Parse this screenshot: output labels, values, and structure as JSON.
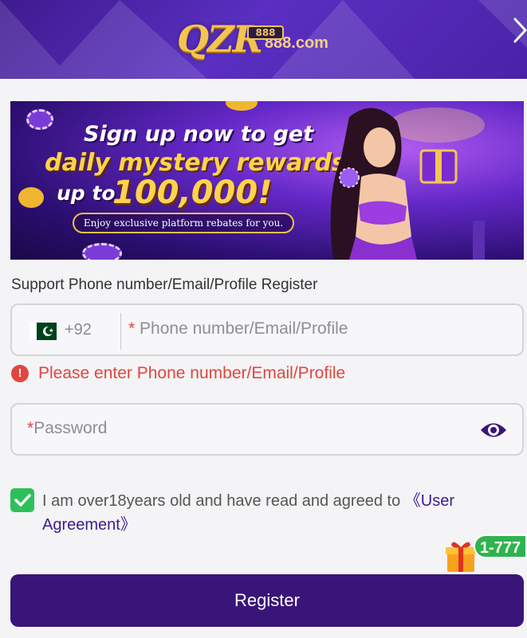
{
  "header": {
    "logo_main": "QZR",
    "logo_badge": "888",
    "logo_domain": "888.com"
  },
  "banner": {
    "line1": "Sign up now to get",
    "line2": "daily mystery rewards",
    "line3_prefix": "up to",
    "line3_amount": "100,000!",
    "subline": "Enjoy exclusive platform rebates for you."
  },
  "form": {
    "section_label": "Support Phone number/Email/Profile Register",
    "country_code": "+92",
    "required_mark": "*",
    "phone_placeholder": "Phone number/Email/Profile",
    "error_text": "Please enter Phone number/Email/Profile",
    "password_placeholder": "Password",
    "agreement_text": "I am over18years old and have read and agreed to ",
    "agreement_link": "《User Agreement》",
    "agreement_checked": true,
    "register_label": "Register"
  },
  "gift": {
    "badge_text": "1-777"
  },
  "colors": {
    "header_purple": "#4a22a8",
    "button_purple": "#3a1579",
    "error_red": "#e0463e",
    "check_green": "#2fbf5a",
    "gold": "#f3c452"
  },
  "icons": {
    "close": "chevron-right-icon",
    "flag": "pakistan-flag-icon",
    "error": "exclamation-circle-icon",
    "eye": "eye-icon",
    "checkbox": "check-icon",
    "gift": "gift-icon"
  }
}
